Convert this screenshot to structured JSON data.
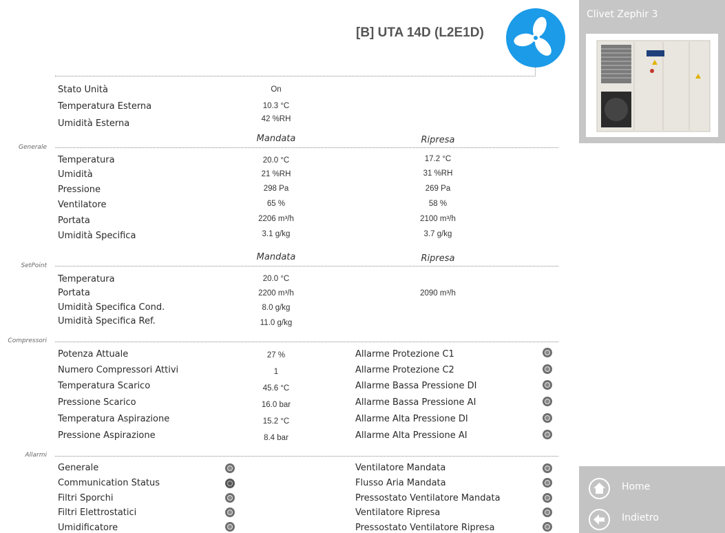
{
  "header": {
    "title": "[B] UTA 14D (L2E1D)",
    "fan_icon": "fan-icon",
    "fan_color": "#1b9be8"
  },
  "sidebar": {
    "device_name": "Clivet Zephir 3",
    "device_image": "clivet-unit-image",
    "nav": [
      {
        "label": "Home",
        "icon": "home-icon"
      },
      {
        "label": "Indietro",
        "icon": "back-arrow-icon"
      }
    ]
  },
  "status": [
    {
      "label": "Stato Unità",
      "value": "On"
    },
    {
      "label": "Temperatura Esterna",
      "value": "10.3 °C"
    },
    {
      "label": "Umidità Esterna",
      "value": "42 %RH"
    }
  ],
  "generale": {
    "section": "Generale",
    "col1": "Mandata",
    "col2": "Ripresa",
    "rows": [
      {
        "label": "Temperatura",
        "mandata": "20.0 °C",
        "ripresa": "17.2 °C"
      },
      {
        "label": "Umidità",
        "mandata": "21 %RH",
        "ripresa": "31 %RH"
      },
      {
        "label": "Pressione",
        "mandata": "298 Pa",
        "ripresa": "269 Pa"
      },
      {
        "label": "Ventilatore",
        "mandata": "65 %",
        "ripresa": "58 %"
      },
      {
        "label": "Portata",
        "mandata": "2206 m³/h",
        "ripresa": "2100 m³/h"
      },
      {
        "label": "Umidità Specifica",
        "mandata": "3.1 g/kg",
        "ripresa": "3.7 g/kg"
      }
    ]
  },
  "setpoint": {
    "section": "SetPoint",
    "col1": "Mandata",
    "col2": "Ripresa",
    "rows": [
      {
        "label": "Temperatura",
        "mandata": "20.0 °C",
        "ripresa": ""
      },
      {
        "label": "Portata",
        "mandata": "2200 m³/h",
        "ripresa": "2090 m³/h"
      },
      {
        "label": "Umidità Specifica Cond.",
        "mandata": "8.0 g/kg",
        "ripresa": ""
      },
      {
        "label": "Umidità Specifica Ref.",
        "mandata": "11.0 g/kg",
        "ripresa": ""
      }
    ]
  },
  "compressori": {
    "section": "Compressori",
    "rows": [
      {
        "label": "Potenza Attuale",
        "value": "27 %"
      },
      {
        "label": "Numero Compressori Attivi",
        "value": "1"
      },
      {
        "label": "Temperatura Scarico",
        "value": "45.6 °C"
      },
      {
        "label": "Pressione Scarico",
        "value": "16.0 bar"
      },
      {
        "label": "Temperatura Aspirazione",
        "value": "15.2 °C"
      },
      {
        "label": "Pressione Aspirazione",
        "value": "8.4 bar"
      }
    ],
    "alarms": [
      "Allarme Protezione C1",
      "Allarme Protezione C2",
      "Allarme Bassa Pressione DI",
      "Allarme Bassa Pressione AI",
      "Allarme Alta Pressione DI",
      "Allarme Alta Pressione AI"
    ]
  },
  "allarmi": {
    "section": "Allarmi",
    "left": [
      "Generale",
      "Communication Status",
      "Filtri Sporchi",
      "Filtri Elettrostatici",
      "Umidificatore"
    ],
    "right": [
      "Ventilatore Mandata",
      "Flusso Aria Mandata",
      "Pressostato Ventilatore Mandata",
      "Ventilatore Ripresa",
      "Pressostato Ventilatore Ripresa"
    ]
  }
}
